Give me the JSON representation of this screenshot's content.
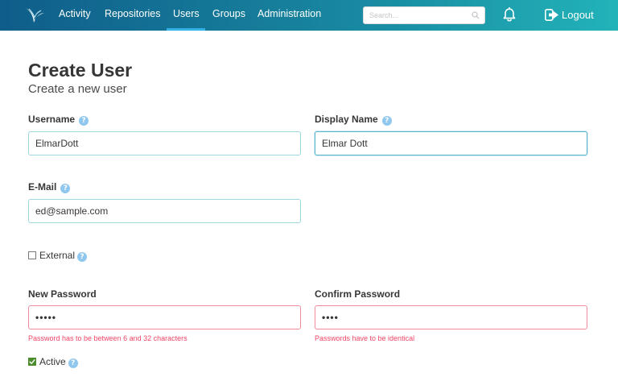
{
  "nav": {
    "links": [
      "Activity",
      "Repositories",
      "Users",
      "Groups",
      "Administration"
    ],
    "active": "Users",
    "search_placeholder": "Search...",
    "logout_label": "Logout",
    "accent_color": "#33b2e8"
  },
  "page": {
    "title": "Create User",
    "subtitle": "Create a new user"
  },
  "form": {
    "username": {
      "label": "Username",
      "value": "ElmarDott"
    },
    "display_name": {
      "label": "Display Name",
      "value": "Elmar Dott"
    },
    "email": {
      "label": "E-Mail",
      "value": "ed@sample.com"
    },
    "external": {
      "label": "External",
      "checked": false
    },
    "new_password": {
      "label": "New Password",
      "value": "•••••",
      "error": "Password has to be between 6 and 32 characters"
    },
    "confirm_password": {
      "label": "Confirm Password",
      "value": "••••",
      "error": "Passwords have to be identical"
    },
    "active": {
      "label": "Active",
      "checked": true
    },
    "help_glyph": "?",
    "error_color": "#f14668",
    "checked_color": "#4c8c2e"
  },
  "icons": {
    "logo": "scm-logo-icon",
    "search": "search-icon",
    "bell": "bell-icon",
    "logout": "logout-icon",
    "help": "help-icon",
    "check": "checkmark-icon"
  }
}
